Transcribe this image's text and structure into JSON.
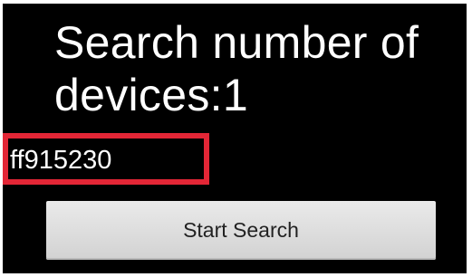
{
  "screen": {
    "heading": "Search number of devices:1",
    "device_id": "ff915230",
    "start_button_label": "Start Search",
    "highlight_color": "#e32636"
  }
}
